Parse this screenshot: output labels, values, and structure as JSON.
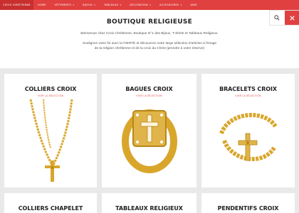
{
  "nav": {
    "items": [
      {
        "label": "CROIX CHRÉTIENNE",
        "active": true
      },
      {
        "label": "HOME",
        "active": false
      },
      {
        "label": "VÊTEMENTS",
        "active": false,
        "caret": true
      },
      {
        "label": "BIJOUX",
        "active": false,
        "caret": true
      },
      {
        "label": "TABLEAUX",
        "active": false,
        "caret": true
      },
      {
        "label": "DÉCORATION",
        "active": false,
        "caret": true
      },
      {
        "label": "ACCESSOIRES",
        "active": false,
        "caret": true
      },
      {
        "label": "AIDE",
        "active": false
      }
    ],
    "caret_glyph": "▾"
  },
  "search": {
    "search_icon": "search-icon",
    "close_icon": "close-icon"
  },
  "header": {
    "title": "BOUTIQUE RELIGIEUSE",
    "line1": "Bienvenue chez Croix Chrétienne, Boutique N°1 des Bijoux, T-Shirts et Tableaux Religieux.",
    "line2": "Soulignez votre foi avec la FIERTÉ et découvrez notre large sélection d'articles à l'image",
    "line3": "de la religion chrétienne et de la croix du Christ (prendre à votre réserve)"
  },
  "cards": [
    {
      "title": "COLLIERS CROIX",
      "link": "VOIR LA SÉLECTION"
    },
    {
      "title": "BAGUES CROIX",
      "link": "VOIR LA SÉLECTION"
    },
    {
      "title": "BRACELETS CROIX",
      "link": "VOIR LA SÉLECTION"
    },
    {
      "title": "COLLIERS CHAPELET",
      "link": ""
    },
    {
      "title": "TABLEAUX RELIGIEUX",
      "link": ""
    },
    {
      "title": "PENDENTIFS CROIX",
      "link": ""
    }
  ],
  "colors": {
    "accent": "#e0403f",
    "gold": "#d9a62c",
    "background_band": "#e9e9e9"
  }
}
